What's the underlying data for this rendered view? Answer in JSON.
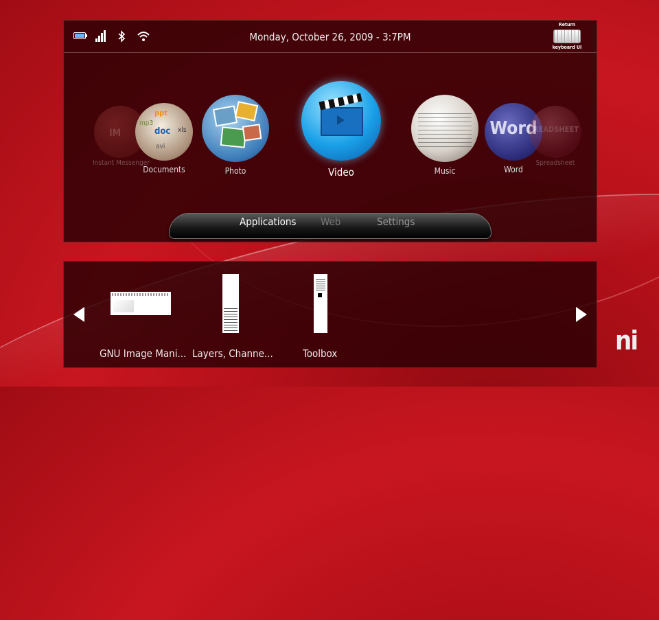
{
  "status": {
    "icons": [
      "battery-icon",
      "signal-bars-icon",
      "bluetooth-icon",
      "wifi-icon"
    ],
    "datetime": "Monday, October 26, 2009 - 3:7PM",
    "keyboard_button": {
      "line1": "Return",
      "line2": "keyboard UI"
    }
  },
  "apps": [
    {
      "name": "Instant Messenger",
      "icon_text": "IM"
    },
    {
      "name": "Documents",
      "icon_text": [
        "ppt",
        "doc",
        "mp3",
        "xls",
        "avi"
      ]
    },
    {
      "name": "Photo"
    },
    {
      "name": "Video",
      "selected": true
    },
    {
      "name": "Music"
    },
    {
      "name": "Word",
      "icon_text": "Word"
    },
    {
      "name": "Spreadsheet",
      "icon_text": "READSHEET"
    }
  ],
  "tabs": [
    {
      "label": "Applications",
      "active": true
    },
    {
      "label": "Web",
      "active": false
    },
    {
      "label": "Settings",
      "active": false
    }
  ],
  "windows": [
    {
      "title": "GNU Image Mani..."
    },
    {
      "title": "Layers, Channe..."
    },
    {
      "title": "Toolbox"
    }
  ],
  "logo_text": "ni",
  "colors": {
    "background": "#c81620",
    "panel": "#280004",
    "video_blue": "#1aa0e8"
  }
}
